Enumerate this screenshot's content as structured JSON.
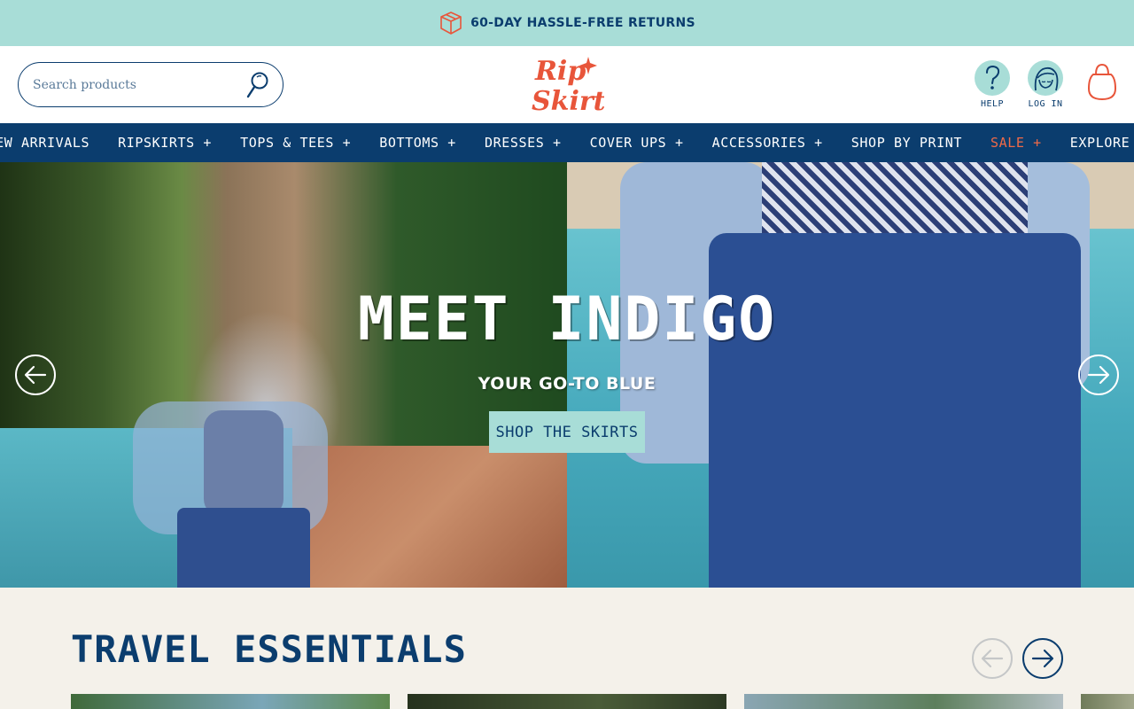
{
  "announcement": {
    "text": "60-DAY HASSLE-FREE RETURNS",
    "icon": "box-icon"
  },
  "header": {
    "search": {
      "placeholder": "Search products",
      "value": ""
    },
    "logo": {
      "line1": "Rip",
      "line2": "Skirt",
      "color": "#e8553a"
    },
    "help_label": "HELP",
    "login_label": "LOG IN"
  },
  "nav": {
    "items": [
      {
        "label": "NEW ARRIVALS"
      },
      {
        "label": "RIPSKIRTS +"
      },
      {
        "label": "TOPS & TEES +"
      },
      {
        "label": "BOTTOMS +"
      },
      {
        "label": "DRESSES +"
      },
      {
        "label": "COVER UPS +"
      },
      {
        "label": "ACCESSORIES +"
      },
      {
        "label": "SHOP BY PRINT"
      },
      {
        "label": "SALE +"
      },
      {
        "label": "EXPLORE +"
      }
    ]
  },
  "hero": {
    "title": "MEET INDIGO",
    "subtitle": "YOUR GO-TO BLUE",
    "cta": "SHOP THE SKIRTS"
  },
  "section": {
    "title": "TRAVEL ESSENTIALS"
  },
  "colors": {
    "navy": "#0b3d6e",
    "mint": "#a8ddd7",
    "sale": "#f06a48",
    "cream": "#f4f1ea"
  }
}
